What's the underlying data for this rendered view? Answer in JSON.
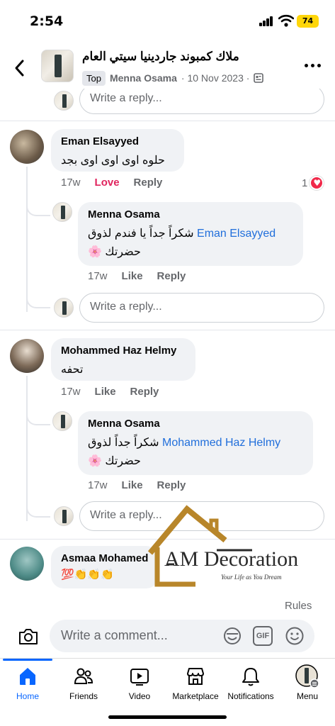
{
  "status_bar": {
    "time": "2:54",
    "battery": "74"
  },
  "header": {
    "group_name": "ملاك كمبوند جاردينيا سيتي العام",
    "badge": "Top",
    "author": "Menna Osama",
    "date": "· 10 Nov 2023 ·"
  },
  "reply_placeholder": "Write a reply...",
  "comments": [
    {
      "name": "Eman Elsayyed",
      "text": "حلوه اوى اوى اوى بجد",
      "time": "17w",
      "reaction_label": "Love",
      "reply_label": "Reply",
      "reaction_count": "1",
      "reply": {
        "name": "Menna Osama",
        "mention": "Eman Elsayyed",
        "text": "شكراً جداً يا فندم لذوق",
        "text2": "حضرتك 🌸",
        "time": "17w",
        "like_label": "Like",
        "reply_label": "Reply"
      }
    },
    {
      "name": "Mohammed Haz Helmy",
      "text": "تحفه",
      "time": "17w",
      "like_label": "Like",
      "reply_label": "Reply",
      "reply": {
        "name": "Menna Osama",
        "mention": "Mohammed Haz Helmy",
        "text": "شكراً جداً لذوق",
        "text2": "حضرتك 🌸",
        "time": "17w",
        "like_label": "Like",
        "reply_label": "Reply"
      }
    },
    {
      "name": "Asmaa Mohamed",
      "text": "💯👏👏👏"
    }
  ],
  "watermark": {
    "brand": "AM Decoration",
    "tagline": "Your Life as You Dream"
  },
  "rules_label": "Rules",
  "composer": {
    "placeholder": "Write a comment...",
    "gif_label": "GIF"
  },
  "tabs": [
    {
      "label": "Home",
      "icon": "home-icon",
      "active": true
    },
    {
      "label": "Friends",
      "icon": "friends-icon"
    },
    {
      "label": "Video",
      "icon": "video-icon"
    },
    {
      "label": "Marketplace",
      "icon": "marketplace-icon"
    },
    {
      "label": "Notifications",
      "icon": "bell-icon"
    },
    {
      "label": "Menu",
      "icon": "menu-avatar-icon"
    }
  ],
  "colors": {
    "accent": "#0866ff",
    "mention": "#216fdb",
    "love": "#e0245e",
    "bubble": "#f0f2f5"
  }
}
